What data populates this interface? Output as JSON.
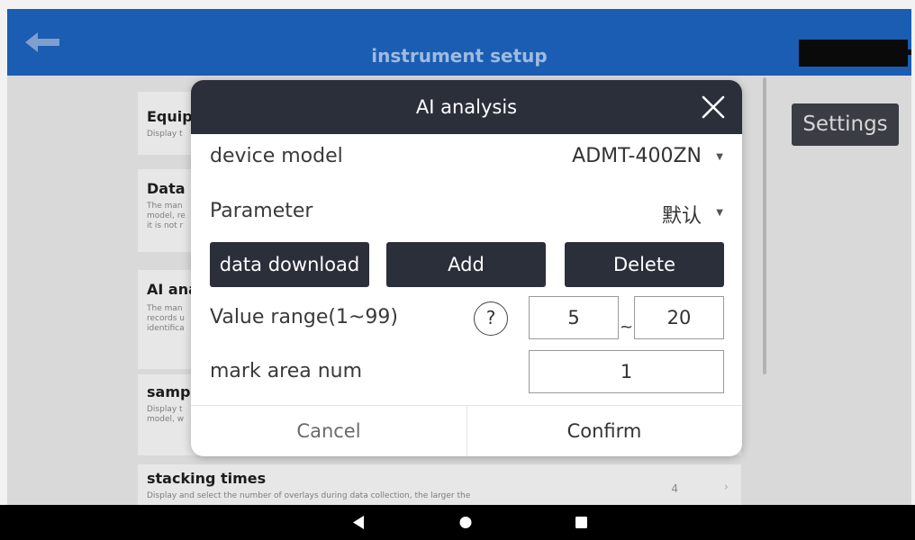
{
  "topbar": {
    "title": "instrument setup"
  },
  "background": {
    "settings_label": "Settings",
    "cards": [
      {
        "title": "Equip",
        "desc": "Display t"
      },
      {
        "title": "Data p",
        "desc_lines": [
          "The man",
          "model, re",
          "it is not r"
        ]
      },
      {
        "title": "AI ana",
        "desc_lines": [
          "The man",
          "records u",
          "identifica"
        ]
      },
      {
        "title": "samp",
        "desc_lines": [
          "Display t",
          "model, w"
        ]
      },
      {
        "title": "stacking times",
        "desc": "Display and select the number of overlays during data collection, the larger the",
        "value": "4"
      }
    ]
  },
  "modal": {
    "title": "AI analysis",
    "device_model": {
      "label": "device model",
      "value": "ADMT-400ZN"
    },
    "parameter": {
      "label": "Parameter",
      "value": "默认"
    },
    "buttons": {
      "download": "data download",
      "add": "Add",
      "delete": "Delete"
    },
    "value_range": {
      "label": "Value range(1~99)",
      "help": "?",
      "min": "5",
      "separator": "~",
      "max": "20"
    },
    "mark_area": {
      "label": "mark area num",
      "value": "1"
    },
    "cancel_label": "Cancel",
    "confirm_label": "Confirm"
  },
  "icons": {
    "back": "arrow-left-icon",
    "close": "close-icon",
    "nav_back": "nav-back-icon",
    "nav_home": "nav-home-icon",
    "nav_recents": "nav-recents-icon"
  },
  "colors": {
    "topbar": "#1a5db3",
    "dark": "#2b2f3a",
    "overlay": "#d9d9d9"
  }
}
